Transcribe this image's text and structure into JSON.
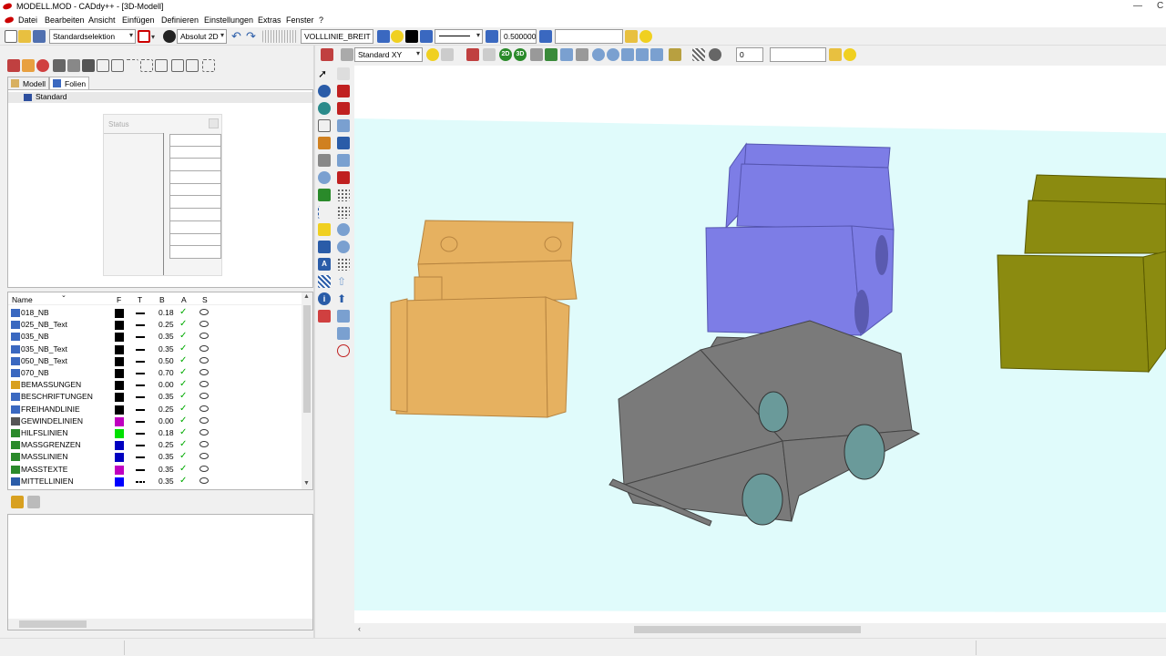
{
  "window": {
    "title": "MODELL.MOD  -  CADdy++ - [3D-Modell]",
    "min_glyph": "—",
    "max_glyph": "C"
  },
  "menu": {
    "items": [
      "Datei",
      "Bearbeiten",
      "Ansicht",
      "Einfügen",
      "Definieren",
      "Einstellungen",
      "Extras",
      "Fenster",
      "?"
    ]
  },
  "toolbar1": {
    "selection_mode": "Standardselektion",
    "coord_mode": "Absolut 2D",
    "line_type": "VOLLLINIE_BREIT",
    "line_width": "0.500000",
    "empty_field": ""
  },
  "toolbar2": {
    "view": "Standard XY",
    "btn_2d": "2D",
    "btn_3d": "3D",
    "spin_value": "0",
    "empty_field": ""
  },
  "left_panel": {
    "tabs": [
      "Modell",
      "Folien"
    ],
    "active_tab": "Folien",
    "tree_root": "Standard",
    "status_title": "Status",
    "layer_columns": {
      "name": "Name",
      "f": "F",
      "t": "T",
      "b": "B",
      "a": "A",
      "s": "S"
    },
    "layers": [
      {
        "name": "018_NB",
        "color": "#000000",
        "width": "0.18",
        "line": "solid"
      },
      {
        "name": "025_NB_Text",
        "color": "#000000",
        "width": "0.25",
        "line": "solid"
      },
      {
        "name": "035_NB",
        "color": "#000000",
        "width": "0.35",
        "line": "solid"
      },
      {
        "name": "035_NB_Text",
        "color": "#000000",
        "width": "0.35",
        "line": "solid"
      },
      {
        "name": "050_NB_Text",
        "color": "#000000",
        "width": "0.50",
        "line": "solid"
      },
      {
        "name": "070_NB",
        "color": "#000000",
        "width": "0.70",
        "line": "solid"
      },
      {
        "name": "BEMASSUNGEN",
        "color": "#000000",
        "width": "0.00",
        "line": "solid"
      },
      {
        "name": "BESCHRIFTUNGEN",
        "color": "#000000",
        "width": "0.35",
        "line": "solid"
      },
      {
        "name": "FREIHANDLINIE",
        "color": "#000000",
        "width": "0.25",
        "line": "solid"
      },
      {
        "name": "GEWINDELINIEN",
        "color": "#c000c0",
        "width": "0.00",
        "line": "solid"
      },
      {
        "name": "HILFSLINIEN",
        "color": "#00e000",
        "width": "0.18",
        "line": "solid"
      },
      {
        "name": "MASSGRENZEN",
        "color": "#0000c0",
        "width": "0.25",
        "line": "solid"
      },
      {
        "name": "MASSLINIEN",
        "color": "#0000c0",
        "width": "0.35",
        "line": "solid"
      },
      {
        "name": "MASSTEXTE",
        "color": "#c000c0",
        "width": "0.35",
        "line": "solid"
      },
      {
        "name": "MITTELLINIEN",
        "color": "#0000ff",
        "width": "0.35",
        "line": "dash"
      }
    ]
  },
  "viewport": {
    "background_color": "#e0fbfb",
    "models": [
      {
        "name": "orange-jeep",
        "color": "#e8a545"
      },
      {
        "name": "blue-jeep",
        "color": "#7d7de6"
      },
      {
        "name": "grey-jeep",
        "color": "#7a7a7a"
      },
      {
        "name": "olive-jeep",
        "color": "#8b8b10"
      }
    ]
  }
}
